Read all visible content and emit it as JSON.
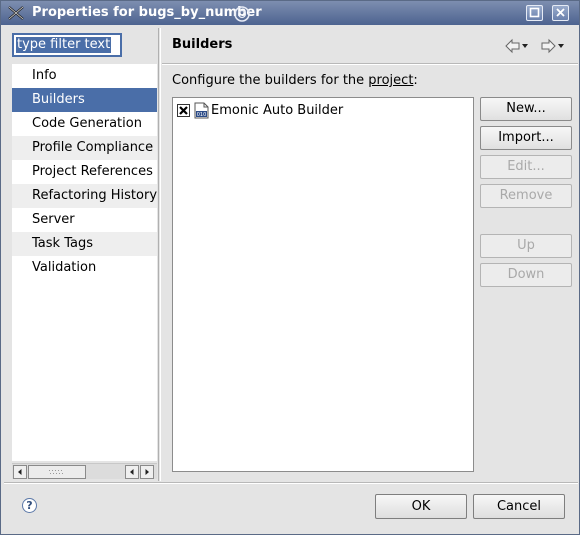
{
  "window": {
    "title": "Properties for bugs_by_number"
  },
  "filter": {
    "value": "type filter text"
  },
  "nav": {
    "items": [
      {
        "label": "Info"
      },
      {
        "label": "Builders"
      },
      {
        "label": "Code Generation"
      },
      {
        "label": "Profile Compliance and Validation"
      },
      {
        "label": "Project References"
      },
      {
        "label": "Refactoring History"
      },
      {
        "label": "Server"
      },
      {
        "label": "Task Tags"
      },
      {
        "label": "Validation"
      }
    ],
    "selected": "Builders"
  },
  "page": {
    "title": "Builders",
    "description_prefix": "Configure the builders for the ",
    "description_link": "project",
    "description_suffix": ":"
  },
  "builders": [
    {
      "label": "Emonic Auto Builder",
      "enabled": true
    }
  ],
  "buttons": {
    "new": "New...",
    "import": "Import...",
    "edit": "Edit...",
    "remove": "Remove",
    "up": "Up",
    "down": "Down"
  },
  "dialog": {
    "ok": "OK",
    "cancel": "Cancel"
  },
  "colors": {
    "selection": "#4a6ea8",
    "titlebar": "#5a6f9a"
  },
  "icons": {
    "app": "eclipse-icon",
    "back": "back-arrow-icon",
    "forward": "forward-arrow-icon",
    "help": "help-icon",
    "builder": "binary-builder-icon"
  }
}
